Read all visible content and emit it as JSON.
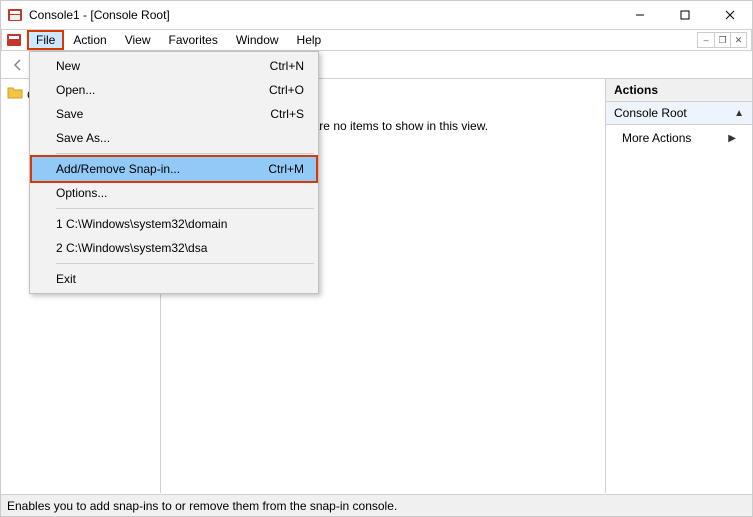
{
  "window": {
    "title": "Console1 - [Console Root]"
  },
  "menubar": {
    "file": "File",
    "action": "Action",
    "view": "View",
    "favorites": "Favorites",
    "window": "Window",
    "help": "Help"
  },
  "file_menu": {
    "new": {
      "label": "New",
      "shortcut": "Ctrl+N"
    },
    "open": {
      "label": "Open...",
      "shortcut": "Ctrl+O"
    },
    "save": {
      "label": "Save",
      "shortcut": "Ctrl+S"
    },
    "save_as": {
      "label": "Save As...",
      "shortcut": ""
    },
    "add_remove": {
      "label": "Add/Remove Snap-in...",
      "shortcut": "Ctrl+M"
    },
    "options": {
      "label": "Options...",
      "shortcut": ""
    },
    "recent1": {
      "label": "1 C:\\Windows\\system32\\domain",
      "shortcut": ""
    },
    "recent2": {
      "label": "2 C:\\Windows\\system32\\dsa",
      "shortcut": ""
    },
    "exit": {
      "label": "Exit",
      "shortcut": ""
    }
  },
  "tree": {
    "root": "Console Root"
  },
  "main": {
    "empty_text": "There are no items to show in this view."
  },
  "actions": {
    "header": "Actions",
    "node": "Console Root",
    "more": "More Actions"
  },
  "statusbar": {
    "text": "Enables you to add snap-ins to or remove them from the snap-in console."
  }
}
